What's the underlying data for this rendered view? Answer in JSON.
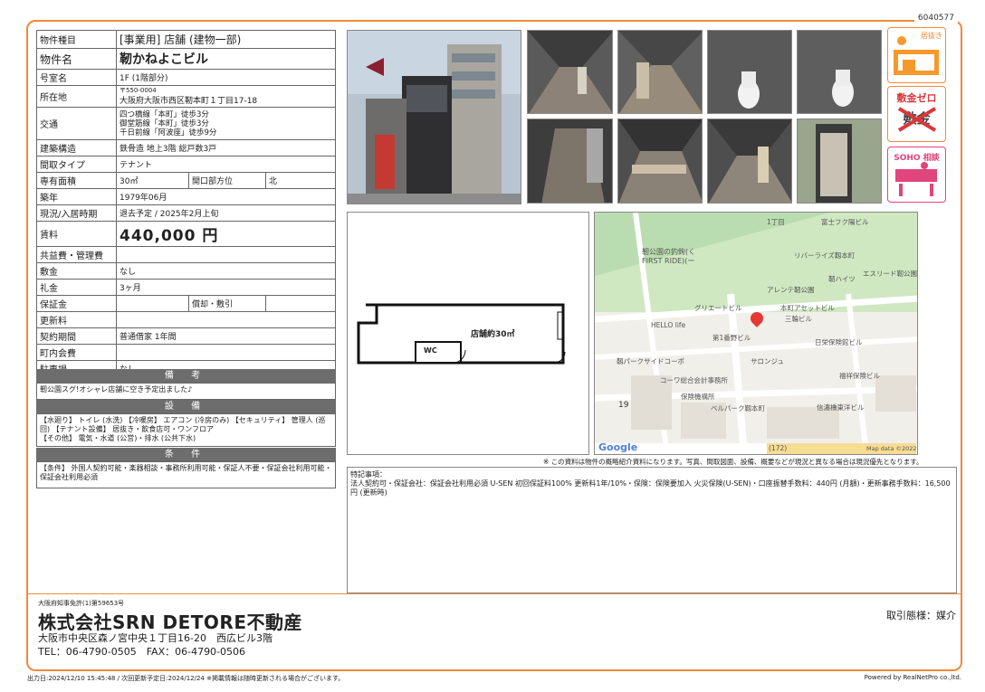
{
  "doc_number": "6040577",
  "property": {
    "type_label": "物件種目",
    "type_value": "[事業用] 店舗 (建物一部)",
    "name_label": "物件名",
    "name_value": "靭かねよこビル",
    "room_label": "号室名",
    "room_value": "1F (1階部分)",
    "location_label": "所在地",
    "postal": "〒550-0004",
    "address": "大阪府大阪市西区靭本町１丁目17-18",
    "transport_label": "交通",
    "transport": [
      "四つ橋線「本町」徒歩3分",
      "御堂筋線「本町」徒歩3分",
      "千日前線「阿波座」徒歩9分"
    ],
    "structure_label": "建築構造",
    "structure_value": "鉄骨造 地上3階 総戸数3戸",
    "layout_label": "間取タイプ",
    "layout_value": "テナント",
    "area_label": "専有面積",
    "area_value": "30㎡",
    "opening_label": "開口部方位",
    "opening_value": "北",
    "built_label": "築年",
    "built_value": "1979年06月",
    "status_label": "現況/入居時期",
    "status_value": "退去予定 / 2025年2月上旬",
    "rent_label": "賃料",
    "rent_value": "440,000 円",
    "fee_label": "共益費・管理費",
    "fee_value": "",
    "deposit_label": "敷金",
    "deposit_value": "なし",
    "key_money_label": "礼金",
    "key_money_value": "3ヶ月",
    "security_label": "保証金",
    "security_value": "",
    "amort_label": "償却・敷引",
    "amort_value": "",
    "renewal_label": "更新料",
    "renewal_value": "",
    "contract_label": "契約期間",
    "contract_value": "普通借家 1年間",
    "community_label": "町内会費",
    "community_value": "",
    "parking_label": "駐車場",
    "parking_value": "なし"
  },
  "remarks": {
    "title": "備 考",
    "text": "靭公園スグ!オシャレ店舗に空き予定出ました♪"
  },
  "facilities": {
    "title": "設 備",
    "text": "【水廻り】 トイレ (水洗) 【冷暖房】 エアコン (冷房のみ) 【セキュリティ】 管理人 (巡回) 【テナント設備】 居抜き・飲食店可・ワンフロア\n【その他】 電気・水道 (公営)・排水 (公共下水)"
  },
  "conditions": {
    "title": "条 件",
    "text": "【条件】 外国人契約可能・楽器相談・事務所利用可能・保証人不要・保証会社利用可能・保証会社利用必須"
  },
  "badges": {
    "b1": "居抜き",
    "b2": "敷金ゼロ",
    "b2_sub": "敷金",
    "b3": "SOHO 相談"
  },
  "plan": {
    "label": "店舗約30㎡",
    "wc": "WC"
  },
  "map": {
    "google": "Google",
    "mapdata": "Map data ©2022",
    "num19": "19",
    "labels": [
      "1丁目",
      "靭公園の釣鉤(く",
      "FIRST RIDE)(ー",
      "リバーライズ靱本町",
      "エスリード靭公園",
      "グリエートビル",
      "HELLO life",
      "本町アセットビル",
      "三輪ビル",
      "第1番野ビル",
      "日栄保険館ビル",
      "靱パークサイドコーポ",
      "サロンジュ",
      "コーワ総合会計事務所",
      "保険機構所",
      "ベルパーク靱本町",
      "信濃橋東洋ビル",
      "福祥保険ビル",
      "靭ハイツ",
      "アレンテ靭公園",
      "富士フク陽ビル",
      "(172)"
    ]
  },
  "disclaimer": "※ この資料は物件の概略紹介資料になります。写真、間取図面、設備、概要などが現況と異なる場合は現況優先となります。",
  "notes": {
    "title": "特記事項：",
    "text": "法人契約可・保証会社：保証会社利用必須 U-SEN 初回保証料100% 更新料1年/10%・保険：保険要加入 火災保険(U-SEN)・口座振替手数料：440円 (月額)・更新事務手数料：16,500円 (更新時)"
  },
  "company": {
    "license": "大阪府知事免許(1)第59653号",
    "name": "株式会社SRN DETORE不動産",
    "address": "大阪市中央区森ノ宮中央１丁目16-20　西広ビル3階",
    "tel": "TEL：06-4790-0505　FAX：06-4790-0506",
    "deal": "取引態様：媒介"
  },
  "footer": {
    "printed": "出力日:2024/12/10 15:45:48 / 次回更新予定日:2024/12/24 ※掲載情報は随時更新される場合がございます。",
    "powered": "Powered by RealNetPro co.,ltd."
  },
  "colors": {
    "accent": "#f08a3c",
    "section_header": "#6d6d6d",
    "pin": "#e53935",
    "badge_red": "#d9383a",
    "badge_pink": "#e0457b"
  }
}
